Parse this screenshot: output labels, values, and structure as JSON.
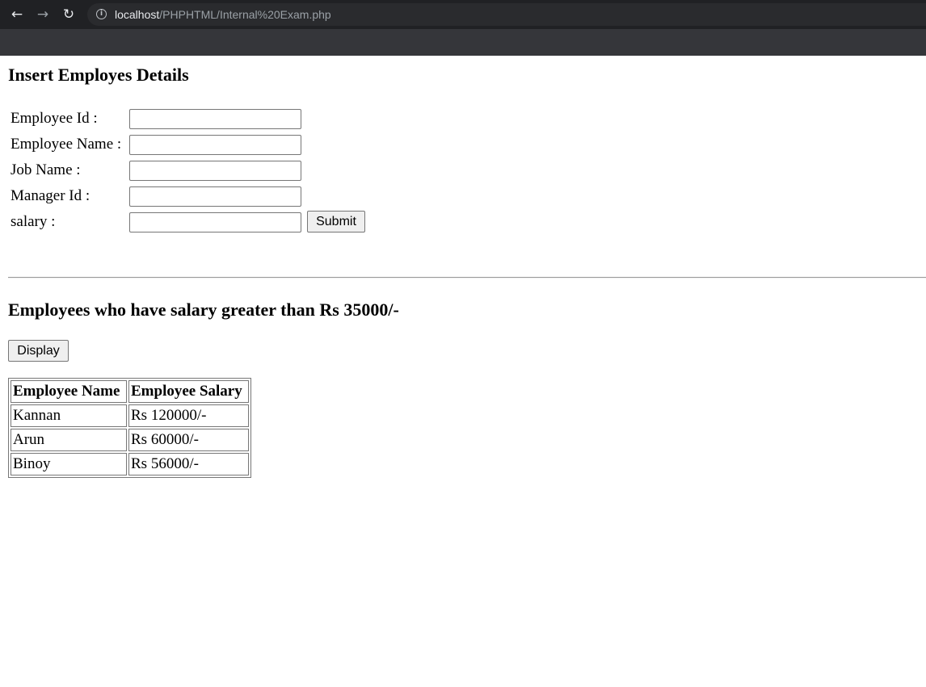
{
  "browser": {
    "url_host": "localhost",
    "url_path": "/PHPHTML/Internal%20Exam.php"
  },
  "insert_section": {
    "title": "Insert Employes Details",
    "fields": [
      {
        "label": "Employee Id :",
        "value": ""
      },
      {
        "label": "Employee Name :",
        "value": ""
      },
      {
        "label": "Job Name :",
        "value": ""
      },
      {
        "label": "Manager Id :",
        "value": ""
      },
      {
        "label": "salary :",
        "value": ""
      }
    ],
    "submit_label": "Submit"
  },
  "display_section": {
    "title": "Employees who have salary greater than Rs 35000/-",
    "display_label": "Display",
    "table": {
      "headers": [
        "Employee Name",
        "Employee Salary"
      ],
      "rows": [
        [
          "Kannan",
          "Rs 120000/-"
        ],
        [
          "Arun",
          "Rs 60000/-"
        ],
        [
          "Binoy",
          "Rs 56000/-"
        ]
      ]
    }
  }
}
